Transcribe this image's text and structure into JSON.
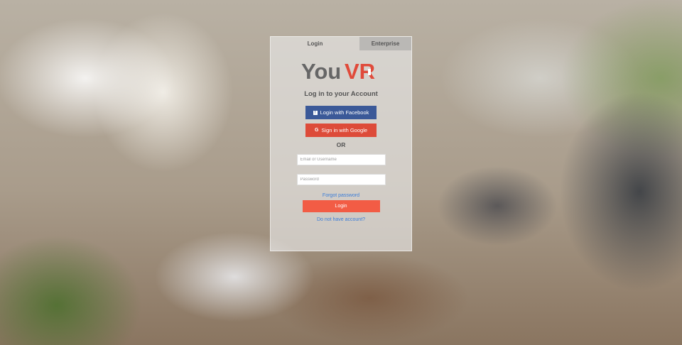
{
  "tabs": [
    {
      "label": "Login"
    },
    {
      "label": "Enterprise"
    }
  ],
  "logo": {
    "part1": "You",
    "part2": "VR",
    "part1_color": "#666666",
    "part2_color": "#e04a3a"
  },
  "heading": "Log in to your Account",
  "social": {
    "facebook_label": "Login with Facebook",
    "facebook_icon": "facebook-icon",
    "facebook_color": "#3b5998",
    "google_label": "Sign in with Google",
    "google_icon": "google-icon",
    "google_color": "#dd4b39"
  },
  "separator": "OR",
  "form": {
    "email_placeholder": "Email or Username",
    "password_placeholder": "Password",
    "forgot_label": "Forgot password",
    "login_label": "Login",
    "login_color": "#f25c45",
    "signup_label": "Do not have account?"
  }
}
